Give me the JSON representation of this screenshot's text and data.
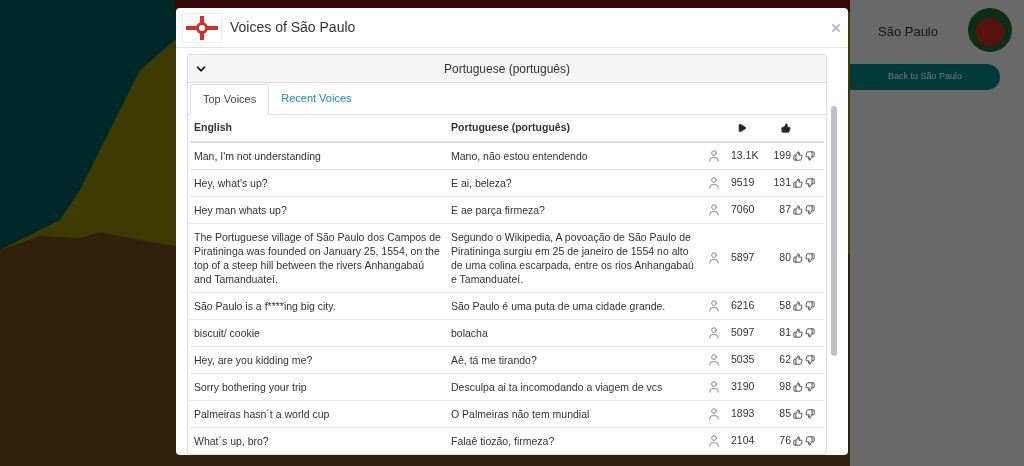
{
  "background": {
    "kind": "picture",
    "city_panel": {
      "city": "São Paulo",
      "back_button": "Back to São Paulo"
    }
  },
  "dialog": {
    "title": "Voices of São Paulo",
    "language_section": {
      "title": "Portuguese (português)",
      "expanded": true
    },
    "tabs": [
      {
        "label": "Top Voices",
        "selected": true
      },
      {
        "label": "Recent Voices",
        "selected": false
      }
    ],
    "table": {
      "columns": [
        "English",
        "Portuguese (português)"
      ],
      "rows": [
        {
          "english": "Man, I'm not understanding",
          "portuguese": "Mano, não estou entendendo",
          "plays": "13.1K",
          "likes": "199"
        },
        {
          "english": "Hey, what's up?",
          "portuguese": "E ai, beleza?",
          "plays": "9519",
          "likes": "131"
        },
        {
          "english": "Hey man whats up?",
          "portuguese": "E ae parça firmeza?",
          "plays": "7060",
          "likes": "87"
        },
        {
          "english": "The Portuguese village of São Paulo dos Campos de Piratininga was founded on January 25, 1554, on the top of a steep hill between the rivers Anhangabaú and Tamanduateí.",
          "portuguese": "Segundo o Wikipedia, A povoação de São Paulo de Piratininga surgiu em 25 de janeiro de 1554 no alto de uma colina escarpada, entre os rios Anhangabaú e Tamanduateí.",
          "plays": "5897",
          "likes": "80"
        },
        {
          "english": "São Paulo is a f****ing big city.",
          "portuguese": "São Paulo é uma puta de uma cidade grande.",
          "plays": "6216",
          "likes": "58"
        },
        {
          "english": "biscuit/ cookie",
          "portuguese": "bolacha",
          "plays": "5097",
          "likes": "81"
        },
        {
          "english": "Hey, are you kidding me?",
          "portuguese": "Aê, tá me tirando?",
          "plays": "5035",
          "likes": "62"
        },
        {
          "english": "Sorry bothering your trip",
          "portuguese": "Desculpa ai ta incomodando a viagem de vcs",
          "plays": "3190",
          "likes": "98"
        },
        {
          "english": "Palmeiras hasn´t a world cup",
          "portuguese": "O Palmeiras não tem mundial",
          "plays": "1893",
          "likes": "85"
        },
        {
          "english": "What´s up, bro?",
          "portuguese": "Falaê tiozão, firmeza?",
          "plays": "2104",
          "likes": "76"
        }
      ]
    }
  }
}
